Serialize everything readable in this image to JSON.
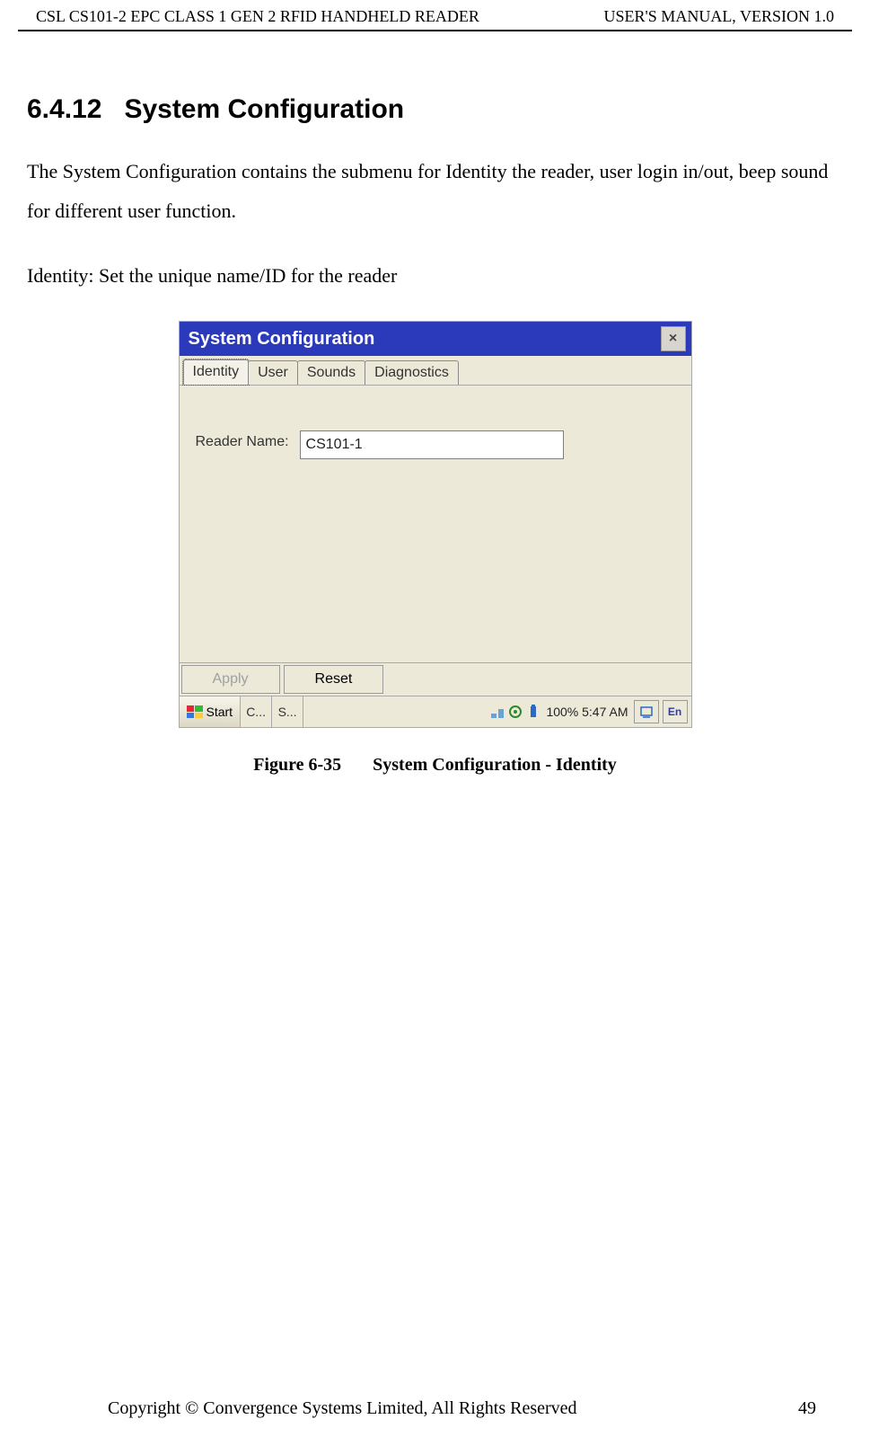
{
  "header": {
    "left": "CSL CS101-2 EPC CLASS 1 GEN 2 RFID HANDHELD READER",
    "right": "USER'S  MANUAL,  VERSION  1.0"
  },
  "section": {
    "number": "6.4.12",
    "title": "System Configuration"
  },
  "paragraph1": "The System Configuration contains the submenu for Identity the reader, user login in/out, beep sound for different user function.",
  "paragraph2": "Identity: Set the unique name/ID for the reader",
  "window": {
    "title": "System Configuration",
    "close_symbol": "×",
    "tabs": {
      "identity": "Identity",
      "user": "User",
      "sounds": "Sounds",
      "diagnostics": "Diagnostics"
    },
    "reader_label": "Reader Name:",
    "reader_value": "CS101-1",
    "buttons": {
      "apply": "Apply",
      "reset": "Reset"
    },
    "taskbar": {
      "start": "Start",
      "slot1": "C...",
      "slot2": "S...",
      "battery_time": "100% 5:47 AM",
      "lang": "En"
    }
  },
  "figure": {
    "number": "Figure 6-35",
    "caption": "System Configuration - Identity"
  },
  "footer": {
    "copyright": "Copyright © Convergence Systems Limited, All Rights Reserved",
    "page": "49"
  }
}
